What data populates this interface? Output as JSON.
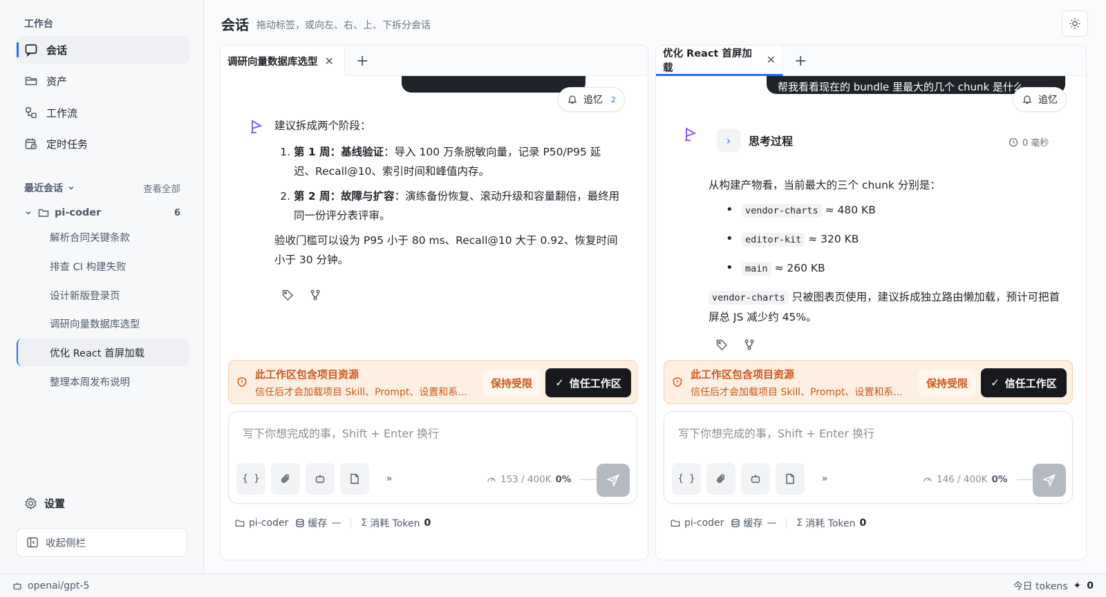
{
  "sidebar": {
    "section_title": "工作台",
    "nav": [
      {
        "label": "会话",
        "icon": "chat-icon"
      },
      {
        "label": "资产",
        "icon": "folder-icon"
      },
      {
        "label": "工作流",
        "icon": "workflow-icon"
      },
      {
        "label": "定时任务",
        "icon": "calendar-clock-icon"
      }
    ],
    "recent_title": "最近会话",
    "view_all": "查看全部",
    "project": {
      "name": "pi-coder",
      "count": "6"
    },
    "conversations": [
      "解析合同关键条款",
      "排查 CI 构建失败",
      "设计新版登录页",
      "调研向量数据库选型",
      "优化 React 首屏加载",
      "整理本周发布说明"
    ],
    "active_conversation": "优化 React 首屏加载",
    "settings": "设置",
    "collapse": "收起侧栏"
  },
  "header": {
    "title": "会话",
    "subtitle": "拖动标签，或向左、右、上、下拆分会话"
  },
  "status_bar": {
    "model": "openai/gpt-5",
    "today_tokens_label": "今日 tokens",
    "today_tokens_value": "0"
  },
  "left_pane": {
    "tab_title": "调研向量数据库选型",
    "user_bubble": "",
    "recall_label": "追忆",
    "recall_count": "2",
    "intro": "建议拆成两个阶段：",
    "steps": [
      {
        "num": "第 1 周：",
        "title": "基线验证",
        "text": "：导入 100 万条脱敏向量，记录 P50/P95 延迟、Recall@10、索引时间和峰值内存。"
      },
      {
        "num": "第 2 周：",
        "title": "故障与扩容",
        "text": "：演练备份恢复、滚动升级和容量翻倍，最终用同一份评分表评审。"
      }
    ],
    "conclusion": "验收门槛可以设为 P95 小于 80 ms、Recall@10 大于 0.92、恢复时间小于 30 分钟。",
    "warning": {
      "title": "此工作区包含项目资源",
      "subtitle": "信任后才会加载项目 Skill、Prompt、设置和系...",
      "keep": "保持受限",
      "trust": "信任工作区"
    },
    "composer": {
      "placeholder": "写下你想完成的事，Shift + Enter 换行",
      "ctx_used": "153 / 400K",
      "ctx_pct": "0%"
    },
    "meta": {
      "project": "pi-coder",
      "cache_label": "缓存",
      "cache_value": "—",
      "token_label": "消耗 Token",
      "token_value": "0"
    }
  },
  "right_pane": {
    "tab_title": "优化 React 首屏加载",
    "user_bubble": "帮我看看现在的 bundle 里最大的几个 chunk 是什么。",
    "recall_label": "追忆",
    "thinking_label": "思考过程",
    "thinking_time": "0 毫秒",
    "intro": "从构建产物看，当前最大的三个 chunk 分别是：",
    "chunks": [
      {
        "name": "vendor-charts",
        "size": "≈ 480 KB"
      },
      {
        "name": "editor-kit",
        "size": "≈ 320 KB"
      },
      {
        "name": "main",
        "size": "≈ 260 KB"
      }
    ],
    "suggestion_code": "vendor-charts",
    "suggestion": "只被图表页使用，建议拆成独立路由懒加载，预计可把首屏总 JS 减少约 45%。",
    "warning": {
      "title": "此工作区包含项目资源",
      "subtitle": "信任后才会加载项目 Skill、Prompt、设置和系...",
      "keep": "保持受限",
      "trust": "信任工作区"
    },
    "composer": {
      "placeholder": "写下你想完成的事，Shift + Enter 换行",
      "ctx_used": "146 / 400K",
      "ctx_pct": "0%"
    },
    "meta": {
      "project": "pi-coder",
      "cache_label": "缓存",
      "cache_value": "—",
      "token_label": "消耗 Token",
      "token_value": "0"
    }
  },
  "colors": {
    "accent": "#1e6bff",
    "warning_bg": "#fdf0e3",
    "warning_text": "#d2561a",
    "ai_logo": "#8b5cf6"
  }
}
